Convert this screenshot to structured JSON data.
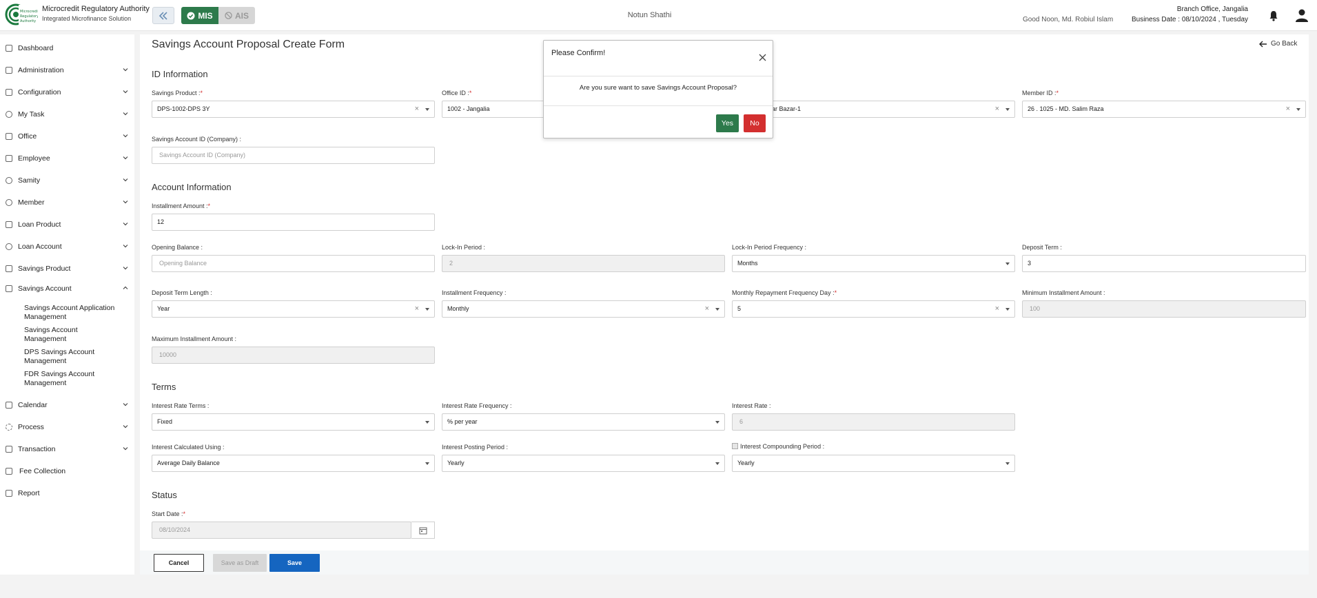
{
  "header": {
    "brand_title": "Microcredit Regulatory Authority",
    "brand_subtitle": "Integrated Microfinance Solution",
    "mis_label": "MIS",
    "ais_label": "AIS",
    "app_name": "Notun Shathi",
    "greeting": "Good Noon, Md. Robiul Islam",
    "branch": "Branch Office, Jangalia",
    "business_date": "Business Date : 08/10/2024 , Tuesday",
    "accent": "#2d7a4b"
  },
  "sidebar": {
    "items": [
      {
        "label": "Dashboard",
        "icon": "grid-icon"
      },
      {
        "label": "Administration",
        "icon": "admin-icon"
      },
      {
        "label": "Configuration",
        "icon": "sliders-icon"
      },
      {
        "label": "My Task",
        "icon": "task-icon"
      },
      {
        "label": "Office",
        "icon": "office-icon"
      },
      {
        "label": "Employee",
        "icon": "employee-icon"
      },
      {
        "label": "Samity",
        "icon": "samity-icon"
      },
      {
        "label": "Member",
        "icon": "member-icon"
      },
      {
        "label": "Loan Product",
        "icon": "loan-product-icon"
      },
      {
        "label": "Loan Account",
        "icon": "loan-account-icon"
      },
      {
        "label": "Savings Product",
        "icon": "savings-product-icon"
      },
      {
        "label": "Savings Account",
        "icon": "savings-account-icon"
      },
      {
        "label": "Calendar",
        "icon": "calendar-icon"
      },
      {
        "label": "Process",
        "icon": "process-icon"
      },
      {
        "label": "Transaction",
        "icon": "transaction-icon"
      },
      {
        "label": "Fee Collection",
        "icon": "fee-icon"
      },
      {
        "label": "Report",
        "icon": "report-icon"
      }
    ],
    "savings_sub": [
      "Savings Account Application Management",
      "Savings Account Management",
      "DPS Savings Account Management",
      "FDR Savings Account Management"
    ]
  },
  "main": {
    "title": "Savings Account Proposal Create Form",
    "go_back": "Go Back",
    "sections": {
      "id_info": "ID Information",
      "account_info": "Account Information",
      "terms": "Terms",
      "status": "Status"
    },
    "fields": {
      "savings_product": {
        "label": "Savings Product :",
        "value": "DPS-1002-DPS 3Y"
      },
      "office_id": {
        "label": "Office ID :",
        "value": "1002 - Jangalia"
      },
      "samity": {
        "value": "lar Bazar-1"
      },
      "member_id": {
        "label": "Member ID :",
        "value": "26 . 1025 - MD. Salim Raza"
      },
      "savings_account_id": {
        "label": "Savings Account ID (Company) :",
        "placeholder": "Savings Account ID (Company)"
      },
      "installment_amount": {
        "label": "Installment Amount :",
        "value": "12"
      },
      "opening_balance": {
        "label": "Opening Balance :",
        "placeholder": "Opening Balance"
      },
      "lockin_period": {
        "label": "Lock-In Period :",
        "value": "2"
      },
      "lockin_freq": {
        "label": "Lock-In Period Frequency :",
        "value": "Months"
      },
      "deposit_term": {
        "label": "Deposit Term :",
        "value": "3"
      },
      "deposit_term_length": {
        "label": "Deposit Term Length :",
        "value": "Year"
      },
      "installment_freq": {
        "label": "Installment Frequency :",
        "value": "Monthly"
      },
      "monthly_repayment_day": {
        "label": "Monthly Repayment Frequency Day :",
        "value": "5"
      },
      "min_installment": {
        "label": "Minimum Installment Amount :",
        "value": "100"
      },
      "max_installment": {
        "label": "Maximum Installment Amount :",
        "value": "10000"
      },
      "interest_rate_terms": {
        "label": "Interest Rate Terms :",
        "value": "Fixed"
      },
      "interest_rate_freq": {
        "label": "Interest Rate Frequency :",
        "value": "% per year"
      },
      "interest_rate": {
        "label": "Interest Rate :",
        "value": "6"
      },
      "interest_calc": {
        "label": "Interest Calculated Using :",
        "value": "Average Daily Balance"
      },
      "interest_posting": {
        "label": "Interest Posting Period :",
        "value": "Yearly"
      },
      "interest_compounding": {
        "label": "Interest Compounding Period :",
        "value": "Yearly"
      },
      "start_date": {
        "label": "Start Date :",
        "value": "08/10/2024"
      }
    },
    "required_mark": "*",
    "buttons": {
      "cancel": "Cancel",
      "draft": "Save as Draft",
      "save": "Save"
    }
  },
  "modal": {
    "title": "Please Confirm!",
    "message": "Are you sure want to save Savings Account Proposal?",
    "yes": "Yes",
    "no": "No"
  }
}
